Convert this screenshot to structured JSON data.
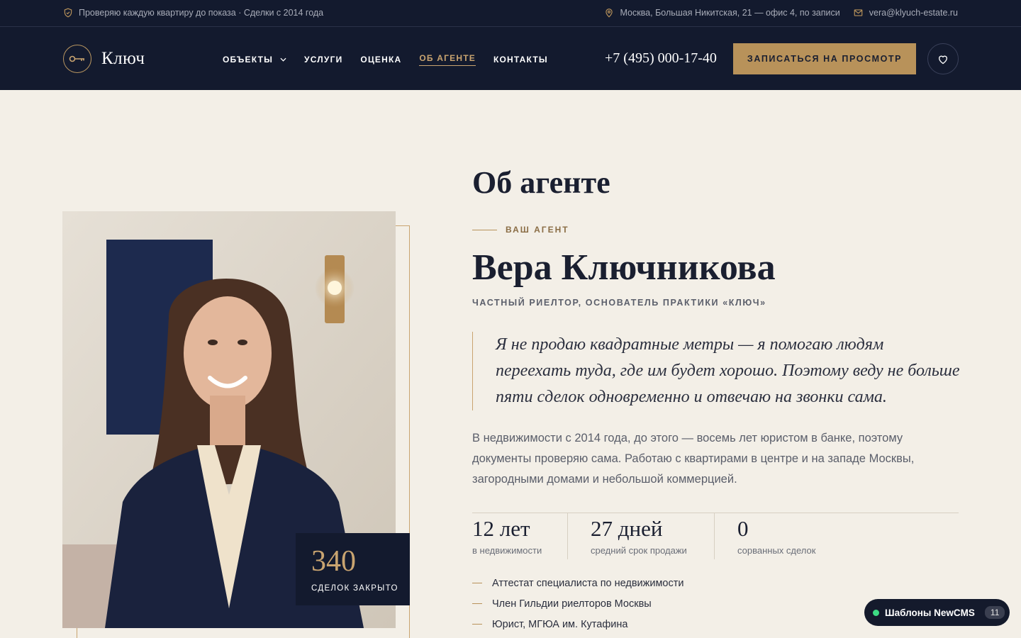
{
  "topbar": {
    "trust_text": "Проверяю каждую квартиру до показа · Сделки с 2014 года",
    "address": "Москва, Большая Никитская, 21 — офис 4, по записи",
    "email": "vera@klyuch-estate.ru"
  },
  "header": {
    "logo_text": "Ключ",
    "nav": [
      {
        "label": "ОБЪЕКТЫ"
      },
      {
        "label": "УСЛУГИ"
      },
      {
        "label": "ОЦЕНКА"
      },
      {
        "label": "ОБ АГЕНТЕ"
      },
      {
        "label": "КОНТАКТЫ"
      }
    ],
    "phone": "+7 (495) 000-17-40",
    "cta_label": "ЗАПИСАТЬСЯ НА ПРОСМОТР"
  },
  "photo_card": {
    "deals_number": "340",
    "deals_label": "СДЕЛОК ЗАКРЫТО"
  },
  "about": {
    "section_title": "Об агенте",
    "eyebrow": "ВАШ АГЕНТ",
    "name": "Вера Ключникова",
    "role": "ЧАСТНЫЙ РИЕЛТОР, ОСНОВАТЕЛЬ ПРАКТИКИ «КЛЮЧ»",
    "quote": "Я не продаю квадратные метры — я помогаю людям переехать туда, где им будет хорошо. Поэтому веду не больше пяти сделок одновременно и отвечаю на звонки сама.",
    "bio": "В недвижимости с 2014 года, до этого — восемь лет юристом в банке, поэтому документы проверяю сама. Работаю с квартирами в центре и на западе Москвы, загородными домами и небольшой коммерцией.",
    "stats": [
      {
        "value": "12 лет",
        "label": "в недвижимости"
      },
      {
        "value": "27 дней",
        "label": "средний срок продажи"
      },
      {
        "value": "0",
        "label": "сорванных сделок"
      }
    ],
    "credentials": [
      "Аттестат специалиста по недвижимости",
      "Член Гильдии риелторов Москвы",
      "Юрист, МГЮА им. Кутафина"
    ]
  },
  "badge": {
    "label": "Шаблоны NewCMS",
    "count": "11"
  },
  "colors": {
    "navy": "#131a2e",
    "gold": "#b8925a",
    "cream": "#f3efe7"
  }
}
